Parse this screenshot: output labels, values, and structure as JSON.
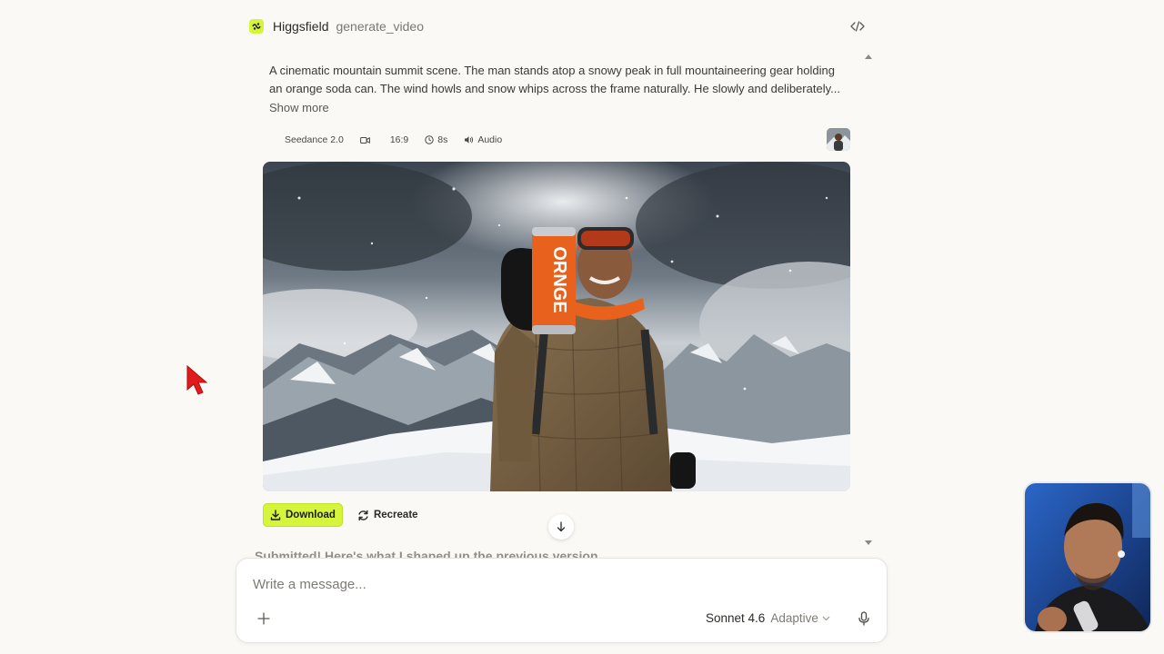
{
  "tool": {
    "name": "Higgsfield",
    "function": "generate_video",
    "code_toggle_icon": "code-icon",
    "brand_color": "#d4f53c"
  },
  "prompt": {
    "text": "A cinematic mountain summit scene. The man stands atop a snowy peak in full mountaineering gear holding an orange soda can. The wind howls and snow whips across the frame naturally. He slowly and deliberately...",
    "show_more": "Show more"
  },
  "meta": {
    "model": "Seedance 2.0",
    "mode_icon": "video-icon",
    "aspect": "16:9",
    "duration": "8s",
    "audio": "Audio"
  },
  "video": {
    "can_text": "ORNGE",
    "accent_color": "#e8621e"
  },
  "actions": {
    "download": "Download",
    "recreate": "Recreate"
  },
  "behind_text": "Submitted! Here's what I shaped up the previous version...",
  "composer": {
    "placeholder": "Write a message...",
    "model": "Sonnet 4.6",
    "mode": "Adaptive"
  }
}
